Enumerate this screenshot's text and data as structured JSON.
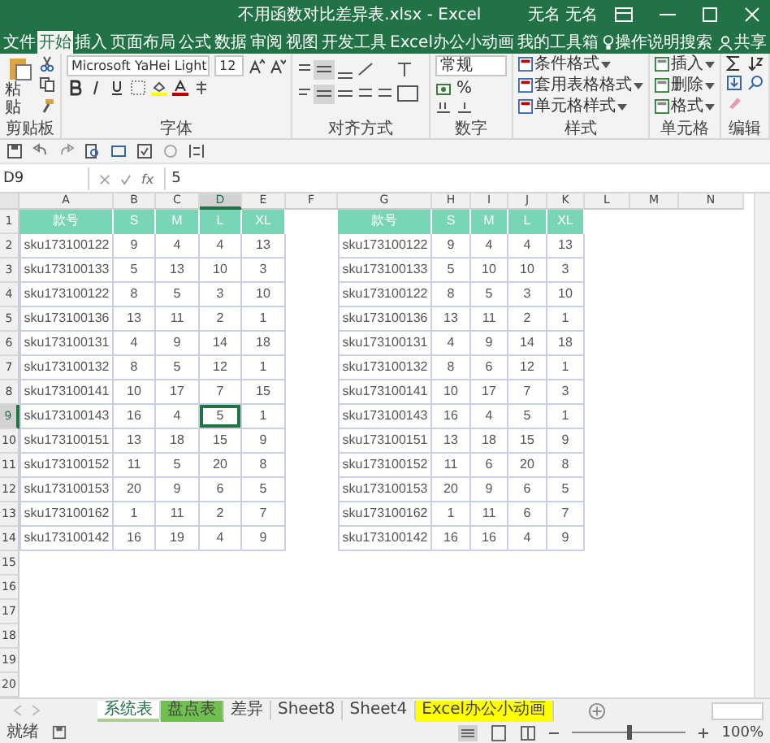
{
  "window": {
    "title": "不用函数对比差异表.xlsx - Excel",
    "user": "无名 无名"
  },
  "menu_tabs": [
    {
      "label": "文件",
      "selected": false
    },
    {
      "label": "开始",
      "selected": true
    },
    {
      "label": "插入",
      "selected": false
    },
    {
      "label": "页面布局",
      "selected": false
    },
    {
      "label": "公式",
      "selected": false
    },
    {
      "label": "数据",
      "selected": false
    },
    {
      "label": "审阅",
      "selected": false
    },
    {
      "label": "视图",
      "selected": false
    },
    {
      "label": "开发工具",
      "selected": false
    },
    {
      "label": "Excel办公小动画",
      "selected": false
    },
    {
      "label": "我的工具箱",
      "selected": false
    }
  ],
  "search": {
    "placeholder": "操作说明搜索"
  },
  "share": "共享",
  "ribbon": [
    {
      "kind": "clipboard",
      "label": "剪贴板",
      "paste": "粘贴"
    },
    {
      "kind": "font",
      "label": "字体",
      "font": "Microsoft YaHei Light",
      "size": "12"
    },
    {
      "kind": "alignment",
      "label": "对齐方式"
    },
    {
      "kind": "number",
      "label": "数字",
      "format": "常规",
      "symbol": "%"
    },
    {
      "kind": "styles",
      "label": "样式",
      "items": [
        "条件格式",
        "套用表格格式",
        "单元格样式"
      ]
    },
    {
      "kind": "cells",
      "label": "单元格",
      "items": [
        "插入",
        "删除",
        "格式"
      ]
    },
    {
      "kind": "editing",
      "label": "编辑"
    }
  ],
  "formula_bar": {
    "cell": "D9",
    "function_label": "fx",
    "value": "5"
  },
  "columns": [
    {
      "label": "A",
      "selected": false
    },
    {
      "label": "B",
      "selected": false
    },
    {
      "label": "C",
      "selected": false
    },
    {
      "label": "D",
      "selected": true
    },
    {
      "label": "E",
      "selected": false
    },
    {
      "label": "F",
      "selected": false
    },
    {
      "label": "G",
      "selected": false
    },
    {
      "label": "H",
      "selected": false
    },
    {
      "label": "I",
      "selected": false
    },
    {
      "label": "J",
      "selected": false
    },
    {
      "label": "K",
      "selected": false
    },
    {
      "label": "L",
      "selected": false
    },
    {
      "label": "M",
      "selected": false
    },
    {
      "label": "N",
      "selected": false
    }
  ],
  "rows": [
    {
      "label": "1",
      "selected": false
    },
    {
      "label": "2",
      "selected": false
    },
    {
      "label": "3",
      "selected": false
    },
    {
      "label": "4",
      "selected": false
    },
    {
      "label": "5",
      "selected": false
    },
    {
      "label": "6",
      "selected": false
    },
    {
      "label": "7",
      "selected": false
    },
    {
      "label": "8",
      "selected": false
    },
    {
      "label": "9",
      "selected": true
    },
    {
      "label": "10",
      "selected": false
    },
    {
      "label": "11",
      "selected": false
    },
    {
      "label": "12",
      "selected": false
    },
    {
      "label": "13",
      "selected": false
    },
    {
      "label": "14",
      "selected": false
    },
    {
      "label": "15",
      "selected": false
    },
    {
      "label": "16",
      "selected": false
    },
    {
      "label": "17",
      "selected": false
    },
    {
      "label": "18",
      "selected": false
    },
    {
      "label": "19",
      "selected": false
    },
    {
      "label": "20",
      "selected": false
    }
  ],
  "tables": [
    {
      "header": [
        "款号",
        "S",
        "M",
        "L",
        "XL"
      ],
      "rows": [
        [
          "sku173100122",
          "9",
          "4",
          "4",
          "13"
        ],
        [
          "sku173100133",
          "5",
          "13",
          "10",
          "3"
        ],
        [
          "sku173100122",
          "8",
          "5",
          "3",
          "10"
        ],
        [
          "sku173100136",
          "13",
          "11",
          "2",
          "1"
        ],
        [
          "sku173100131",
          "4",
          "9",
          "14",
          "18"
        ],
        [
          "sku173100132",
          "8",
          "5",
          "12",
          "1"
        ],
        [
          "sku173100141",
          "10",
          "17",
          "7",
          "15"
        ],
        [
          "sku173100143",
          "16",
          "4",
          "5",
          "1"
        ],
        [
          "sku173100151",
          "13",
          "18",
          "15",
          "9"
        ],
        [
          "sku173100152",
          "11",
          "5",
          "20",
          "8"
        ],
        [
          "sku173100153",
          "20",
          "9",
          "6",
          "5"
        ],
        [
          "sku173100162",
          "1",
          "11",
          "2",
          "7"
        ],
        [
          "sku173100142",
          "16",
          "19",
          "4",
          "9"
        ]
      ]
    },
    {
      "header": [
        "款号",
        "S",
        "M",
        "L",
        "XL"
      ],
      "rows": [
        [
          "sku173100122",
          "9",
          "4",
          "4",
          "13"
        ],
        [
          "sku173100133",
          "5",
          "10",
          "10",
          "3"
        ],
        [
          "sku173100122",
          "8",
          "5",
          "3",
          "10"
        ],
        [
          "sku173100136",
          "13",
          "11",
          "2",
          "1"
        ],
        [
          "sku173100131",
          "4",
          "9",
          "14",
          "18"
        ],
        [
          "sku173100132",
          "8",
          "6",
          "12",
          "1"
        ],
        [
          "sku173100141",
          "10",
          "17",
          "7",
          "3"
        ],
        [
          "sku173100143",
          "16",
          "4",
          "5",
          "1"
        ],
        [
          "sku173100151",
          "13",
          "18",
          "15",
          "9"
        ],
        [
          "sku173100152",
          "11",
          "6",
          "20",
          "8"
        ],
        [
          "sku173100153",
          "20",
          "9",
          "6",
          "5"
        ],
        [
          "sku173100162",
          "1",
          "11",
          "6",
          "7"
        ],
        [
          "sku173100142",
          "16",
          "16",
          "4",
          "9"
        ]
      ]
    }
  ],
  "sheet_tabs": [
    {
      "label": "系统表",
      "selected": true,
      "color": "#a9d08e"
    },
    {
      "label": "盘点表",
      "selected": false,
      "color": "#70c050"
    },
    {
      "label": "差异",
      "selected": false
    },
    {
      "label": "Sheet8",
      "selected": false
    },
    {
      "label": "Sheet4",
      "selected": false
    },
    {
      "label": "Excel办公小动画",
      "selected": false,
      "color": "#ffff00"
    }
  ],
  "status_bar": {
    "status": "就绪",
    "zoom": "100%",
    "zoom_level": {
      "level": 0.5
    }
  }
}
